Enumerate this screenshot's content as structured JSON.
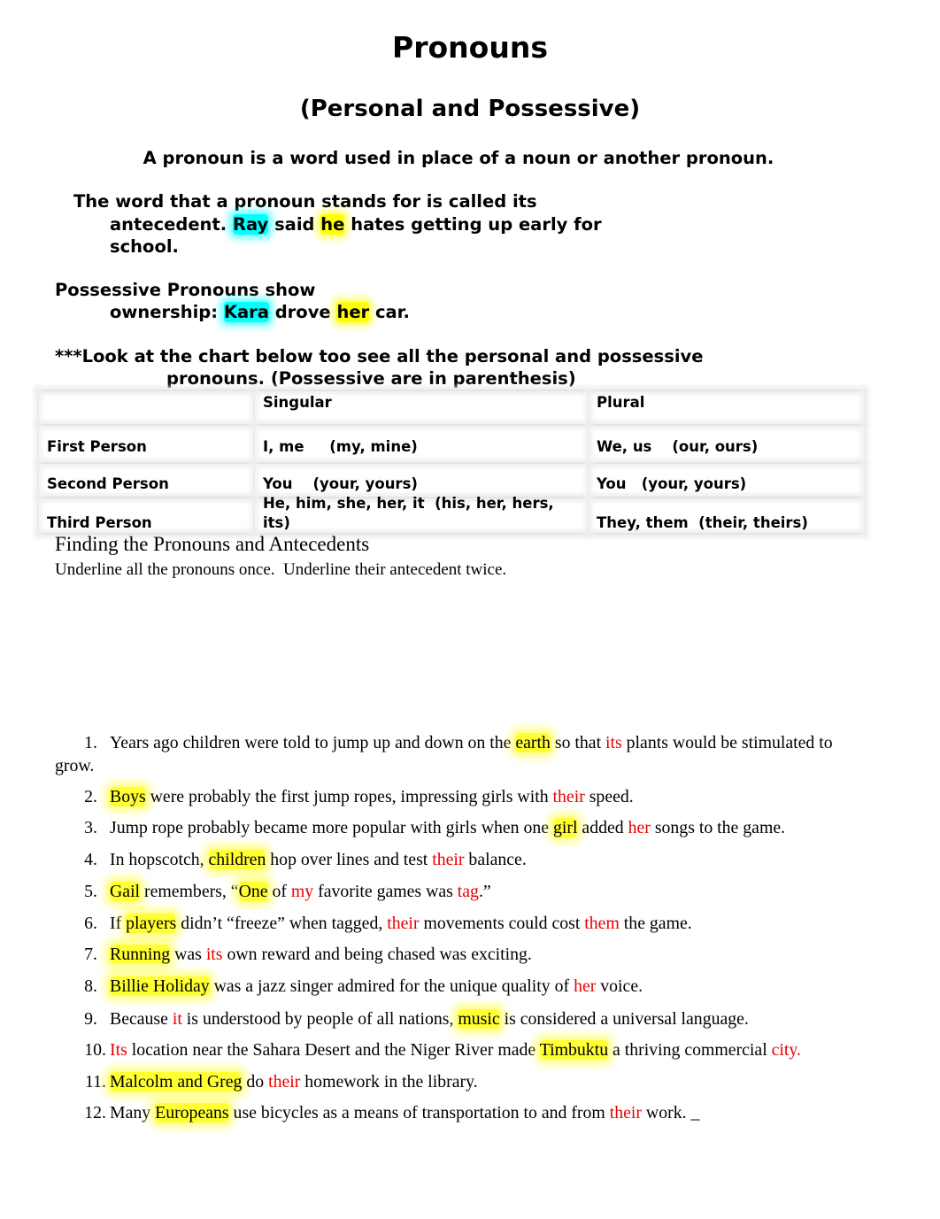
{
  "title": "Pronouns",
  "subtitle": "(Personal and Possessive)",
  "definition": "A pronoun is a word used in place of a noun or another pronoun.",
  "antecedent": {
    "line1": "The word that a pronoun stands for is called its",
    "line2_pre": "antecedent.",
    "example_noun": "Ray",
    "mid": "said",
    "example_pronoun": "he",
    "line2_post": "hates getting up early for",
    "line3": "school."
  },
  "possessive": {
    "line1": "Possessive Pronouns show",
    "line2_pre": "ownership:",
    "example_noun": "Kara",
    "mid": "drove",
    "example_pronoun": "her",
    "post": "car."
  },
  "chart_intro": {
    "line1": "***Look at the chart below too see all the personal and possessive",
    "line2": "pronouns. (Possessive are in parenthesis)"
  },
  "pronoun_chart": {
    "headers": [
      "",
      "Singular",
      "Plural"
    ],
    "rows": [
      {
        "person": "First Person",
        "singular": "I, me     (my, mine)",
        "plural": "We, us    (our, ours)"
      },
      {
        "person": "Second Person",
        "singular": "You    (your, yours)",
        "plural": "You   (your, yours)"
      },
      {
        "person": "Third Person",
        "singular_line1": "He, him, she, her, it  (his, her, hers,",
        "singular_line2": "its)",
        "plural": "They, them  (their, theirs)"
      }
    ]
  },
  "exercise": {
    "heading": "Finding the Pronouns and Antecedents",
    "instruction": "Underline all the pronouns once.  Underline their antecedent twice.",
    "items": [
      {
        "num": "1.",
        "segments": [
          [
            "t",
            "Years ago children were told to jump up and down on the "
          ],
          [
            "a",
            "earth"
          ],
          [
            "t",
            " so that "
          ],
          [
            "p",
            "its"
          ],
          [
            "t",
            " plants would be stimulated to"
          ]
        ],
        "wrap": "grow."
      },
      {
        "num": "2.",
        "segments": [
          [
            "a",
            "Boys"
          ],
          [
            "t",
            " were probably the first jump ropes, impressing girls with "
          ],
          [
            "p",
            "their"
          ],
          [
            "t",
            " speed."
          ]
        ]
      },
      {
        "num": "3.",
        "segments": [
          [
            "t",
            "Jump rope probably became more popular with girls when one "
          ],
          [
            "a",
            "girl"
          ],
          [
            "t",
            " added "
          ],
          [
            "p",
            "her"
          ],
          [
            "t",
            " songs to the game."
          ]
        ]
      },
      {
        "num": "4.",
        "segments": [
          [
            "t",
            "In hopscotch, "
          ],
          [
            "a",
            "children"
          ],
          [
            "t",
            " hop over lines and test "
          ],
          [
            "p",
            "their"
          ],
          [
            "t",
            " balance."
          ]
        ]
      },
      {
        "num": "5.",
        "segments": [
          [
            "a",
            "Gail"
          ],
          [
            "t",
            " remembers, “"
          ],
          [
            "a",
            "One"
          ],
          [
            "t",
            " of "
          ],
          [
            "p",
            "my"
          ],
          [
            "t",
            " favorite games was "
          ],
          [
            "p",
            "tag"
          ],
          [
            "t",
            ".”"
          ]
        ]
      },
      {
        "num": "6.",
        "segments": [
          [
            "t",
            "If "
          ],
          [
            "a",
            "players"
          ],
          [
            "t",
            " didn’t “freeze” when tagged, "
          ],
          [
            "p",
            "their"
          ],
          [
            "t",
            " movements could cost "
          ],
          [
            "p",
            "them"
          ],
          [
            "t",
            " the game."
          ]
        ]
      },
      {
        "num": "7.",
        "segments": [
          [
            "a",
            "Running"
          ],
          [
            "t",
            " was "
          ],
          [
            "p",
            "its"
          ],
          [
            "t",
            " own reward and being chased was exciting."
          ]
        ]
      },
      {
        "num": "8.",
        "segments": [
          [
            "a",
            "Billie Holiday"
          ],
          [
            "t",
            " was a jazz singer admired for the unique quality of "
          ],
          [
            "p",
            "her"
          ],
          [
            "t",
            " voice."
          ]
        ]
      },
      {
        "num": "9.",
        "segments": [
          [
            "t",
            "Because "
          ],
          [
            "p",
            "it"
          ],
          [
            "t",
            " is understood by people of all nations, "
          ],
          [
            "a",
            "music"
          ],
          [
            "t",
            " is considered a universal language."
          ]
        ]
      },
      {
        "num": "10.",
        "segments": [
          [
            "p",
            "Its"
          ],
          [
            "t",
            " location near the Sahara Desert and the Niger River made "
          ],
          [
            "a",
            "Timbuktu"
          ],
          [
            "t",
            " a thriving commercial "
          ],
          [
            "p",
            "city."
          ]
        ]
      },
      {
        "num": "11.",
        "segments": [
          [
            "a",
            "Malcolm and Greg"
          ],
          [
            "t",
            " do "
          ],
          [
            "p",
            "their"
          ],
          [
            "t",
            " homework in the library."
          ]
        ]
      },
      {
        "num": "12.",
        "segments": [
          [
            "t",
            "Many "
          ],
          [
            "a",
            "Europeans"
          ],
          [
            "t",
            " use bicycles as a means of transportation to and from "
          ],
          [
            "p",
            "their"
          ],
          [
            "t",
            " work. _"
          ]
        ]
      }
    ]
  },
  "colors": {
    "pronoun_text": "#e80000",
    "antecedent_highlight": "#ffff00",
    "example_noun_highlight": "#00ffff",
    "table_grid": "#e4e4e4"
  }
}
